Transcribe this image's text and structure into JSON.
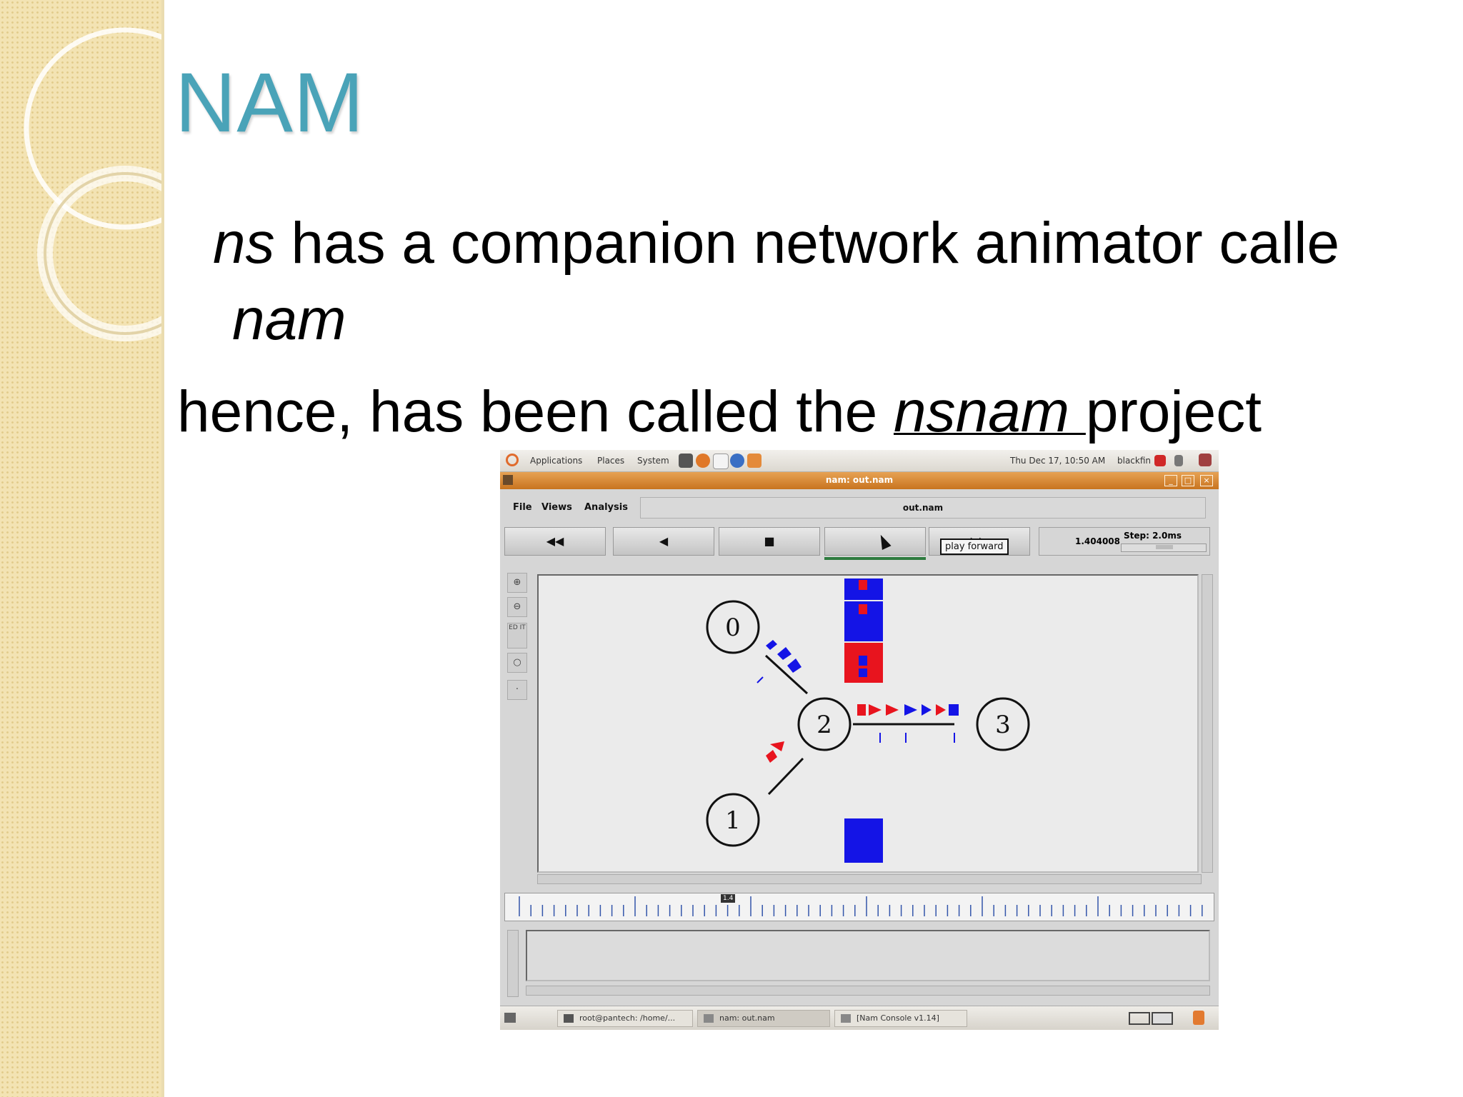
{
  "slide": {
    "title": "NAM",
    "line1_a": "ns",
    "line1_b": " has a companion network animator calle",
    "line2": "nam",
    "line3_a": "hence, has been called the ",
    "line3_b": "nsnam ",
    "line3_c": "project"
  },
  "screenshot": {
    "panel": {
      "menus": [
        "Applications",
        "Places",
        "System"
      ],
      "clock": "Thu Dec 17, 10:50 AM",
      "user": "blackfin"
    },
    "window_title": "nam: out.nam",
    "menubar": {
      "file": "File",
      "views": "Views",
      "analysis": "Analysis",
      "filename": "out.nam"
    },
    "toolbar": {
      "rewind": "◀◀",
      "back": "◀",
      "stop": "■",
      "forward": "▶▶",
      "time": "1.404008",
      "step": "Step: 2.0ms",
      "tooltip": "play forward"
    },
    "left_tools": [
      "zoom-in-icon",
      "zoom-out-icon",
      "edit-icon",
      "circle-icon",
      "dot-icon"
    ],
    "edit_label": "ED IT",
    "nodes": [
      "0",
      "1",
      "2",
      "3"
    ],
    "timeline_marker": "1.4",
    "taskbar": {
      "task1": "root@pantech: /home/...",
      "task2": "nam: out.nam",
      "task3": "[Nam Console v1.14]"
    },
    "colors": {
      "packet_red": "#e8141e",
      "packet_blue": "#1414e6",
      "window_accent": "#d98434"
    }
  }
}
